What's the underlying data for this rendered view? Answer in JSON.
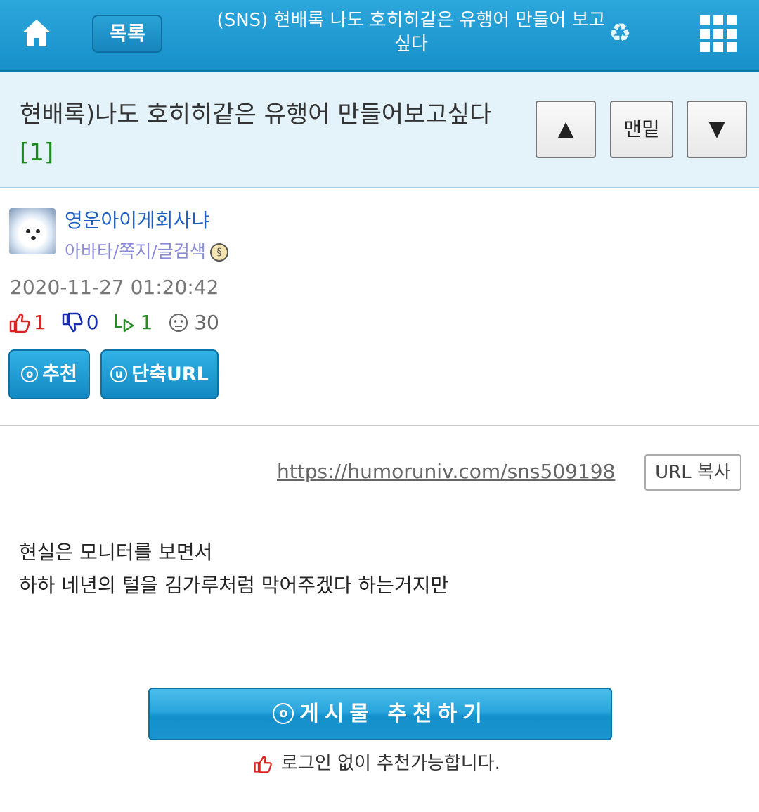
{
  "header": {
    "list_label": "목록",
    "title": "(SNS) 현배록 나도 호히히같은 유행어 만들어 보고싶다",
    "icons": [
      "home-icon",
      "recycle-icon",
      "grid-menu-icon"
    ],
    "accent_color": "#1a94cd"
  },
  "post": {
    "title": "현배록)나도 호히히같은 유행어 만들어보고싶다",
    "comment_count": "[1]",
    "nav": {
      "up": "▲",
      "bottom": "맨밑",
      "down": "▼"
    },
    "author": "영운아이게회사냐",
    "author_links": "아바타/쪽지/글검색",
    "date": "2020-11-27 01:20:42",
    "stats": {
      "up": "1",
      "down": "0",
      "reply": "1",
      "views": "30"
    },
    "buttons": {
      "recommend": "추천",
      "short_url": "단축URL",
      "rec_icon": "o",
      "url_icon": "u"
    },
    "url": "https://humoruniv.com/sns509198",
    "copy_label": "URL 복사",
    "content": [
      "현실은 모니터를 보면서",
      "하하 네년의 털을 김가루처럼 막어주겠다 하는거지만"
    ],
    "big_recommend": "게시물 추천하기",
    "no_login_note": "로그인 없이 추천가능합니다."
  }
}
